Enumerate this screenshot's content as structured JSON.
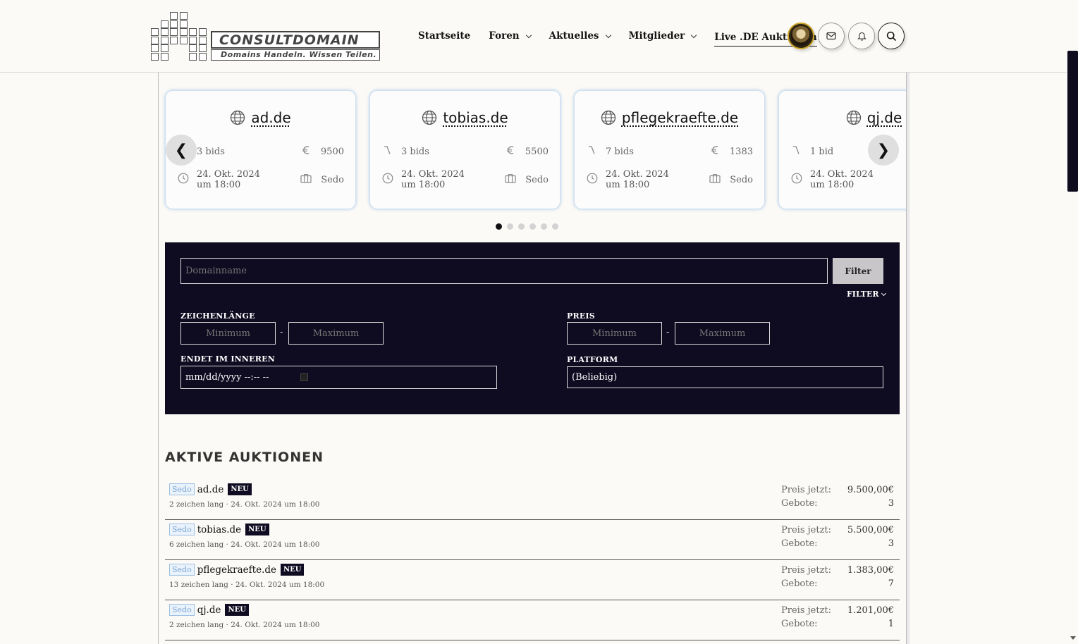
{
  "header": {
    "logo": {
      "title": "CONSULTDOMAIN",
      "tagline": "Domains Handeln. Wissen Teilen."
    },
    "nav": [
      {
        "label": "Startseite",
        "has_menu": false,
        "active": false
      },
      {
        "label": "Foren",
        "has_menu": true,
        "active": false
      },
      {
        "label": "Aktuelles",
        "has_menu": true,
        "active": false
      },
      {
        "label": "Mitglieder",
        "has_menu": true,
        "active": false
      },
      {
        "label": "Live .DE Auktionen",
        "has_menu": false,
        "active": true
      }
    ]
  },
  "carousel": {
    "cards": [
      {
        "domain": "ad.de",
        "bids": "3 bids",
        "price": "9500",
        "date_line1": "24. Okt. 2024",
        "date_line2": "um 18:00",
        "platform": "Sedo"
      },
      {
        "domain": "tobias.de",
        "bids": "3 bids",
        "price": "5500",
        "date_line1": "24. Okt. 2024",
        "date_line2": "um 18:00",
        "platform": "Sedo"
      },
      {
        "domain": "pflegekraefte.de",
        "bids": "7 bids",
        "price": "1383",
        "date_line1": "24. Okt. 2024",
        "date_line2": "um 18:00",
        "platform": "Sedo"
      },
      {
        "domain": "qj.de",
        "bids": "1 bid",
        "price": "",
        "date_line1": "24. Okt. 2024",
        "date_line2": "um 18:00",
        "platform": ""
      }
    ],
    "prev_glyph": "❮",
    "next_glyph": "❯",
    "dot_count": 6,
    "active_dot": 0
  },
  "filter": {
    "domain_placeholder": "Domainname",
    "filter_button": "Filter",
    "toggle_label": "FILTER",
    "length_label": "ZEICHENLÄNGE",
    "price_label": "PREIS",
    "min_placeholder": "Minimum",
    "max_placeholder": "Maximum",
    "dash": "-",
    "ends_label": "ENDET IM INNEREN",
    "date_value": "mm/dd/yyyy --:-- --",
    "platform_label": "PLATFORM",
    "platform_value": "(Beliebig)"
  },
  "auctions": {
    "title": "AKTIVE AUKTIONEN",
    "price_label": "Preis jetzt:",
    "bids_label": "Gebote:",
    "items": [
      {
        "platform": "Sedo",
        "domain": "ad.de",
        "badge": "NEU",
        "sub": "2 zeichen lang · 24. Okt. 2024 um 18:00",
        "price": "9.500,00€",
        "bids": "3"
      },
      {
        "platform": "Sedo",
        "domain": "tobias.de",
        "badge": "NEU",
        "sub": "6 zeichen lang · 24. Okt. 2024 um 18:00",
        "price": "5.500,00€",
        "bids": "3"
      },
      {
        "platform": "Sedo",
        "domain": "pflegekraefte.de",
        "badge": "NEU",
        "sub": "13 zeichen lang · 24. Okt. 2024 um 18:00",
        "price": "1.383,00€",
        "bids": "7"
      },
      {
        "platform": "Sedo",
        "domain": "qj.de",
        "badge": "NEU",
        "sub": "2 zeichen lang · 24. Okt. 2024 um 18:00",
        "price": "1.201,00€",
        "bids": "1"
      }
    ]
  },
  "icons": {
    "globe": "globe-icon",
    "bids": "gavel-icon",
    "price": "euro-icon",
    "date": "clock-icon",
    "platform": "briefcase-icon",
    "mail": "envelope-icon",
    "bell": "bell-icon",
    "search": "search-icon"
  }
}
